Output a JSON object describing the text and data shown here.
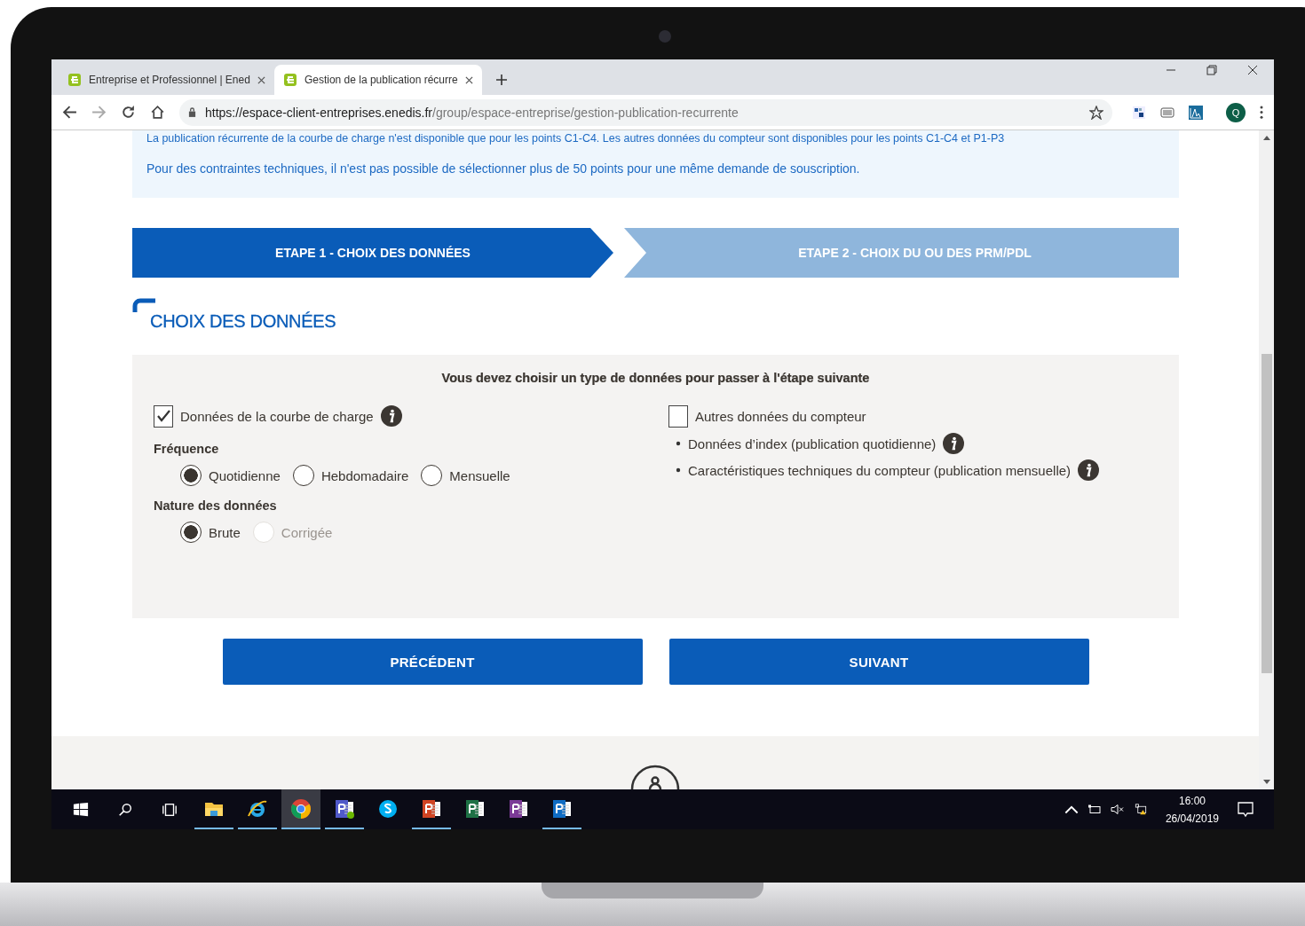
{
  "browser": {
    "tabs": [
      {
        "title": "Entreprise et Professionnel | Ened",
        "selected": false
      },
      {
        "title": "Gestion de la publication récurre",
        "selected": true
      }
    ],
    "address": {
      "host": "https://espace-client-entreprises.enedis.fr",
      "path": "/group/espace-entreprise/gestion-publication-recurrente"
    },
    "profile_initial": "Q"
  },
  "page": {
    "notices": [
      "La publication récurrente de la courbe de charge n'est disponible que pour les points C1-C4. Les autres données du compteur sont disponibles pour les points C1-C4 et P1-P3",
      "Pour des contraintes techniques, il n'est pas possible de sélectionner plus de 50 points pour une même demande de souscription."
    ],
    "steps": [
      {
        "label": "ETAPE 1 - CHOIX DES DONNÉES",
        "selected": true
      },
      {
        "label": "ETAPE 2 - CHOIX DU OU DES PRM/PDL",
        "selected": false
      }
    ],
    "section_title": "CHOIX DES DONNÉES",
    "panel": {
      "instruction": "Vous devez choisir un type de données pour passer à l'étape suivante",
      "load_curve": {
        "label": "Données de la courbe de charge",
        "checked": true
      },
      "frequency": {
        "label": "Fréquence",
        "options": [
          {
            "label": "Quotidienne",
            "selected": true,
            "disabled": false
          },
          {
            "label": "Hebdomadaire",
            "selected": false,
            "disabled": false
          },
          {
            "label": "Mensuelle",
            "selected": false,
            "disabled": false
          }
        ]
      },
      "nature": {
        "label": "Nature des données",
        "options": [
          {
            "label": "Brute",
            "selected": true,
            "disabled": false
          },
          {
            "label": "Corrigée",
            "selected": false,
            "disabled": true
          }
        ]
      },
      "other_data": {
        "label": "Autres données du compteur",
        "checked": false,
        "items": [
          "Données d’index (publication quotidienne)",
          "Caractéristiques techniques du compteur (publication mensuelle)"
        ]
      }
    },
    "buttons": [
      "PRÉCÉDENT",
      "SUIVANT"
    ]
  },
  "taskbar": {
    "apps": [
      {
        "kind": "explorer",
        "open": true,
        "selected": false
      },
      {
        "kind": "ie",
        "open": true,
        "selected": false
      },
      {
        "kind": "chrome",
        "open": true,
        "selected": true
      },
      {
        "kind": "teams",
        "open": true,
        "selected": false
      },
      {
        "kind": "skype",
        "open": false,
        "selected": false
      },
      {
        "kind": "powerpoint",
        "open": true,
        "selected": false
      },
      {
        "kind": "excel",
        "open": false,
        "selected": false
      },
      {
        "kind": "onenote",
        "open": false,
        "selected": false
      },
      {
        "kind": "outlook",
        "open": true,
        "selected": false
      }
    ],
    "time": "16:00",
    "date": "26/04/2019"
  }
}
